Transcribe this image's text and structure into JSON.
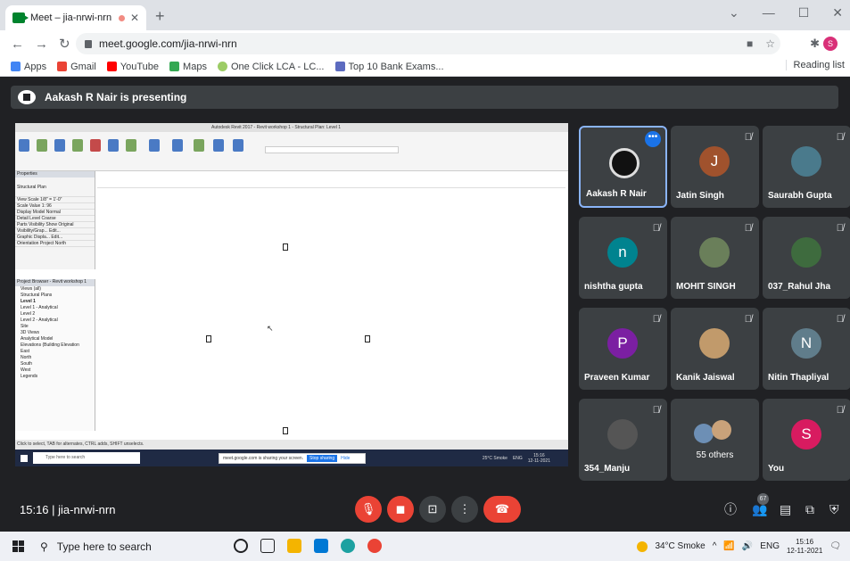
{
  "browser": {
    "tab_title": "Meet – jia-nrwi-nrn",
    "url": "meet.google.com/jia-nrwi-nrn",
    "bookmarks": [
      "Apps",
      "Gmail",
      "YouTube",
      "Maps",
      "One Click LCA - LC...",
      "Top 10 Bank Exams..."
    ],
    "reading_list": "Reading list",
    "profile_initial": "S"
  },
  "meet": {
    "presenting": "Aakash R Nair is presenting",
    "meeting_time": "15:16",
    "meeting_code": "jia-nrwi-nrn",
    "people_count": "67",
    "participants": [
      {
        "name": "Aakash R Nair",
        "initial": "",
        "color": "#111111",
        "active": true
      },
      {
        "name": "Jatin Singh",
        "initial": "J",
        "color": "#a0522d",
        "active": false
      },
      {
        "name": "Saurabh Gupta",
        "initial": "",
        "color": "#4a7a8c",
        "active": false
      },
      {
        "name": "nishtha gupta",
        "initial": "n",
        "color": "#00838f",
        "active": false
      },
      {
        "name": "MOHIT SINGH",
        "initial": "",
        "color": "#6a7f5a",
        "active": false
      },
      {
        "name": "037_Rahul Jha",
        "initial": "",
        "color": "#3e6b3e",
        "active": false
      },
      {
        "name": "Praveen Kumar",
        "initial": "P",
        "color": "#7b1fa2",
        "active": false
      },
      {
        "name": "Kanik Jaiswal",
        "initial": "",
        "color": "#c19a6b",
        "active": false
      },
      {
        "name": "Nitin Thapliyal",
        "initial": "N",
        "color": "#607d8b",
        "active": false
      },
      {
        "name": "354_Manju",
        "initial": "",
        "color": "#555555",
        "active": false
      },
      {
        "name": "55 others",
        "initial": "",
        "color": "#6d8fb5",
        "active": false
      },
      {
        "name": "You",
        "initial": "S",
        "color": "#d81b60",
        "active": false
      }
    ]
  },
  "shared_screen": {
    "title": "Autodesk Revit 2017 - Revit workshop 1 - Structural Plan: Level 1",
    "properties": "Properties",
    "plan_type": "Structural Plan",
    "prop_rows": [
      "View Scale 1/8\" = 1'-0\"",
      "Scale Value 1: 96",
      "Display Model Normal",
      "Detail Level Coarse",
      "Parts Visibility Show Original",
      "Visibility/Grap... Edit...",
      "Graphic Displa... Edit...",
      "Orientation Project North"
    ],
    "browser_title": "Project Browser - Revit workshop 1",
    "browser_rows": [
      "Views (all)",
      "Structural Plans",
      "Level 1",
      "Level 1 - Analytical",
      "Level 2",
      "Level 2 - Analytical",
      "Site",
      "3D Views",
      "Analytical Model",
      "Elevations (Building Elevation",
      "East",
      "North",
      "South",
      "West",
      "Legends"
    ],
    "status": "Click to select, TAB for alternates, CTRL adds, SHIFT unselects.",
    "share_msg": "meet.google.com is sharing your screen.",
    "stop": "Stop sharing",
    "hide": "Hide",
    "inner_search": "Type here to search",
    "inner_weather": "25°C Smoke",
    "inner_lang": "ENG",
    "inner_time": "15:16",
    "inner_date": "12-11-2021"
  },
  "taskbar": {
    "search": "Type here to search",
    "weather": "34°C Smoke",
    "lang": "ENG",
    "time": "15:16",
    "date": "12-11-2021"
  }
}
